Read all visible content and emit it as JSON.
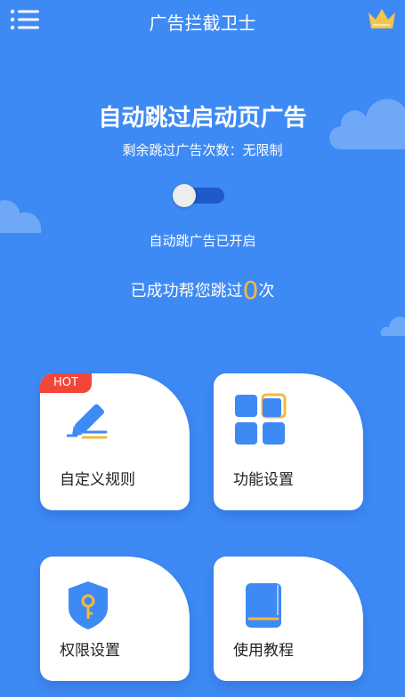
{
  "app": {
    "title": "广告拦截卫士"
  },
  "hero": {
    "headline": "自动跳过启动页广告",
    "remaining_label": "剩余跳过广告次数：无限制",
    "status": "自动跳广告已开启",
    "count_prefix": "已成功帮您跳过",
    "count_value": "0",
    "count_suffix": "次"
  },
  "cards": [
    {
      "label": "自定义规则",
      "badge": "HOT",
      "icon": "pencil-icon"
    },
    {
      "label": "功能设置",
      "icon": "grid-icon"
    },
    {
      "label": "权限设置",
      "icon": "shield-key-icon"
    },
    {
      "label": "使用教程",
      "icon": "book-icon"
    }
  ],
  "colors": {
    "background": "#3E8AF5",
    "accent": "#F6B93B",
    "badge": "#F2463A",
    "icon_blue": "#3E8AF5"
  }
}
